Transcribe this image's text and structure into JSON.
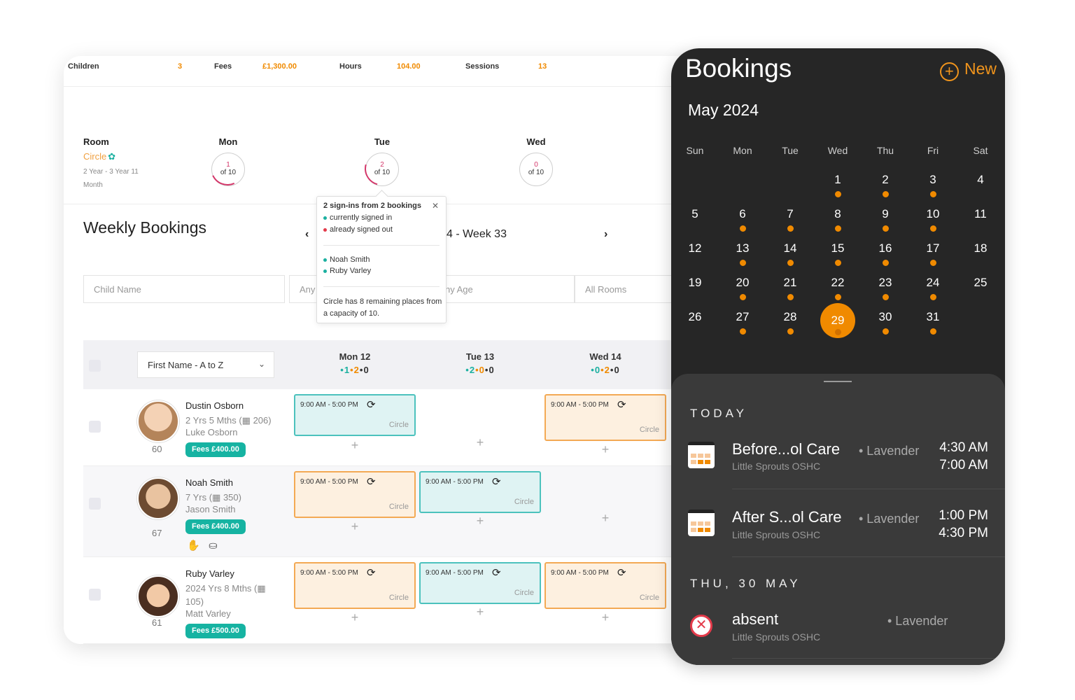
{
  "stats": {
    "children_label": "Children",
    "children_value": "3",
    "fees_label": "Fees",
    "fees_value": "£1,300.00",
    "hours_label": "Hours",
    "hours_value": "104.00",
    "sessions_label": "Sessions",
    "sessions_value": "13"
  },
  "room": {
    "label": "Room",
    "name": "Circle",
    "age": "2 Year - 3 Year 11 Month",
    "days": [
      {
        "name": "Mon",
        "count": "1",
        "of": "of 10"
      },
      {
        "name": "Tue",
        "count": "2",
        "of": "of 10"
      },
      {
        "name": "Wed",
        "count": "0",
        "of": "of 10"
      }
    ]
  },
  "weekly": {
    "title": "Weekly Bookings",
    "prev": "‹",
    "week_label": "4 - Week 33",
    "next": "›"
  },
  "filters": {
    "child_name": "Child Name",
    "any": "Any",
    "any_age": "ny Age",
    "all_rooms": "All Rooms"
  },
  "tooltip": {
    "heading": "2 sign-ins from 2 bookings",
    "close": "✕",
    "legend_in": "currently signed in",
    "legend_out": "already signed out",
    "kid1": "Noah Smith",
    "kid2": "Ruby Varley",
    "note": "Circle has 8 remaining places from a capacity of 10.",
    "color_in": "#1bb0a0",
    "color_out": "#e33a4a"
  },
  "grid": {
    "sort": "First Name - A to Z",
    "columns": [
      {
        "day": "Mon 12",
        "a": "1",
        "b": "2",
        "c": "0"
      },
      {
        "day": "Tue 13",
        "a": "2",
        "b": "0",
        "c": "0"
      },
      {
        "day": "Wed 14",
        "a": "0",
        "b": "2",
        "c": "0"
      }
    ],
    "booking_time": "9:00 AM - 5:00 PM",
    "booking_room": "Circle",
    "rows": [
      {
        "name": "Dustin Osborn",
        "age": "2 Yrs 5 Mths (▦ 206)",
        "parent": "Luke Osborn",
        "fees": "Fees £400.00",
        "num": "60"
      },
      {
        "name": "Noah Smith",
        "age": "7 Yrs (▦ 350)",
        "parent": "Jason Smith",
        "fees": "Fees £400.00",
        "num": "67"
      },
      {
        "name": "Ruby Varley",
        "age": "2024 Yrs 8 Mths (▦ 105)",
        "parent": "Matt Varley",
        "fees": "Fees £500.00",
        "num": "61"
      }
    ]
  },
  "phone": {
    "title": "Bookings",
    "new_label": "New",
    "month": "May 2024",
    "weekdays": [
      "Sun",
      "Mon",
      "Tue",
      "Wed",
      "Thu",
      "Fri",
      "Sat"
    ],
    "days": [
      "1",
      "2",
      "3",
      "4",
      "5",
      "6",
      "7",
      "8",
      "9",
      "10",
      "11",
      "12",
      "13",
      "14",
      "15",
      "16",
      "17",
      "18",
      "19",
      "20",
      "21",
      "22",
      "23",
      "24",
      "25",
      "26",
      "27",
      "28",
      "29",
      "30",
      "31"
    ],
    "selected_day": "29",
    "accent": "#f08a00",
    "today_label": "TODAY",
    "events_today": [
      {
        "title": "Before...ol Care",
        "sub": "Little Sprouts OSHC",
        "room": "• Lavender",
        "start": "4:30 AM",
        "end": "7:00 AM"
      },
      {
        "title": "After S...ol Care",
        "sub": "Little Sprouts OSHC",
        "room": "• Lavender",
        "start": "1:00 PM",
        "end": "4:30 PM"
      }
    ],
    "next_label": "THU, 30 MAY",
    "absent": {
      "title": "absent",
      "sub": "Little Sprouts OSHC",
      "room": "• Lavender"
    }
  }
}
